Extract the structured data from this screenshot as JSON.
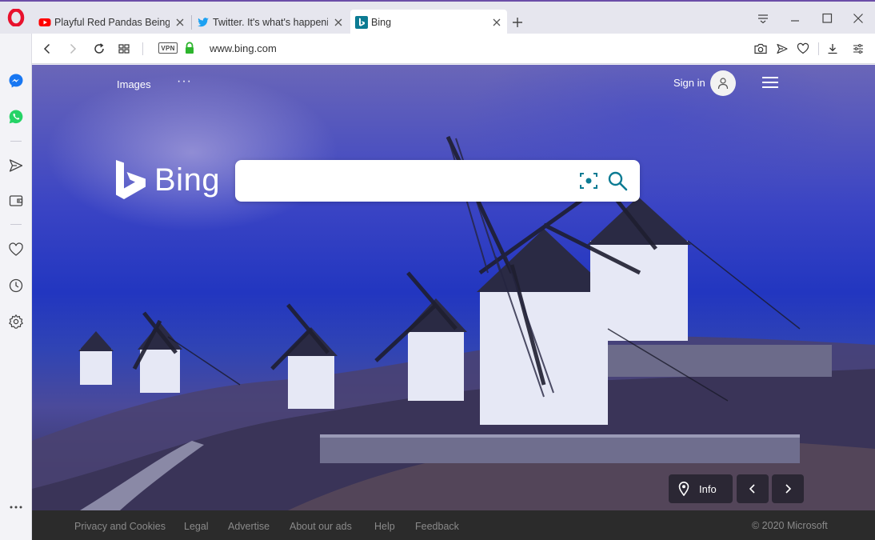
{
  "browser": {
    "tabs": [
      {
        "title": "Playful Red Pandas Being S",
        "favicon": "youtube-icon",
        "active": false
      },
      {
        "title": "Twitter. It's what's happenin",
        "favicon": "twitter-icon",
        "active": false
      },
      {
        "title": "Bing",
        "favicon": "bing-icon",
        "active": true
      }
    ],
    "address": {
      "vpn_label": "VPN",
      "url": "www.bing.com"
    },
    "colors": {
      "opera_red": "#e8112d",
      "accent": "#6b4ea8",
      "bing_teal": "#0c7b93"
    }
  },
  "sidebar": {
    "items": [
      "messenger-icon",
      "whatsapp-icon",
      "send-icon",
      "wallet-icon",
      "heart-icon",
      "history-icon",
      "settings-icon",
      "more-icon"
    ]
  },
  "bing": {
    "nav": {
      "images": "Images",
      "more": "···"
    },
    "signin": "Sign in",
    "wordmark": "Bing",
    "search": {
      "value": "",
      "placeholder": ""
    },
    "info_label": "Info",
    "footer": {
      "links": [
        "Privacy and Cookies",
        "Legal",
        "Advertise",
        "About our ads",
        "Help",
        "Feedback"
      ],
      "copyright": "© 2020 Microsoft"
    }
  }
}
